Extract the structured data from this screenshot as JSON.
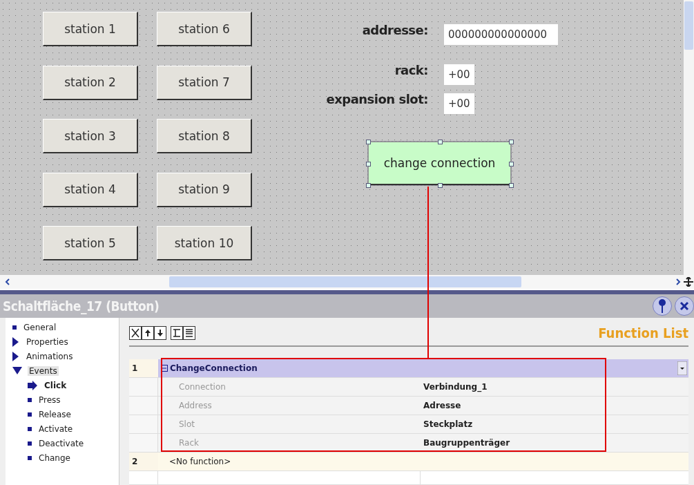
{
  "canvas": {
    "stations": [
      {
        "label": "station 1"
      },
      {
        "label": "station 2"
      },
      {
        "label": "station 3"
      },
      {
        "label": "station 4"
      },
      {
        "label": "station 5"
      },
      {
        "label": "station 6"
      },
      {
        "label": "station 7"
      },
      {
        "label": "station 8"
      },
      {
        "label": "station 9"
      },
      {
        "label": "station 10"
      }
    ],
    "fields": [
      {
        "label": "addresse:",
        "value": "000000000000000"
      },
      {
        "label": "rack:",
        "value": "+00"
      },
      {
        "label": "expansion slot:",
        "value": "+00"
      }
    ],
    "action_button": {
      "label": "change connection",
      "selected": true
    }
  },
  "panel": {
    "title": "Schaltfläche_17 (Button)",
    "nav": [
      {
        "label": "General",
        "kind": "leaf",
        "selected": false
      },
      {
        "label": "Properties",
        "kind": "group",
        "expanded": false,
        "selected": false
      },
      {
        "label": "Animations",
        "kind": "group",
        "expanded": false,
        "selected": false
      },
      {
        "label": "Events",
        "kind": "group",
        "expanded": true,
        "selected": true,
        "children": [
          {
            "label": "Click",
            "selected": true
          },
          {
            "label": "Press",
            "selected": false
          },
          {
            "label": "Release",
            "selected": false
          },
          {
            "label": "Activate",
            "selected": false
          },
          {
            "label": "Deactivate",
            "selected": false
          },
          {
            "label": "Change",
            "selected": false
          }
        ]
      }
    ],
    "list_title": "Function List",
    "functions": [
      {
        "number": "1",
        "name": "ChangeConnection",
        "expanded": true,
        "highlighted": true,
        "params": [
          {
            "name": "Connection",
            "value": "Verbindung_1"
          },
          {
            "name": "Address",
            "value": "Adresse"
          },
          {
            "name": "Slot",
            "value": "Steckplatz"
          },
          {
            "name": "Rack",
            "value": "Baugruppenträger"
          }
        ]
      },
      {
        "number": "2",
        "name": "<No function>",
        "expanded": false,
        "highlighted": false
      }
    ]
  }
}
